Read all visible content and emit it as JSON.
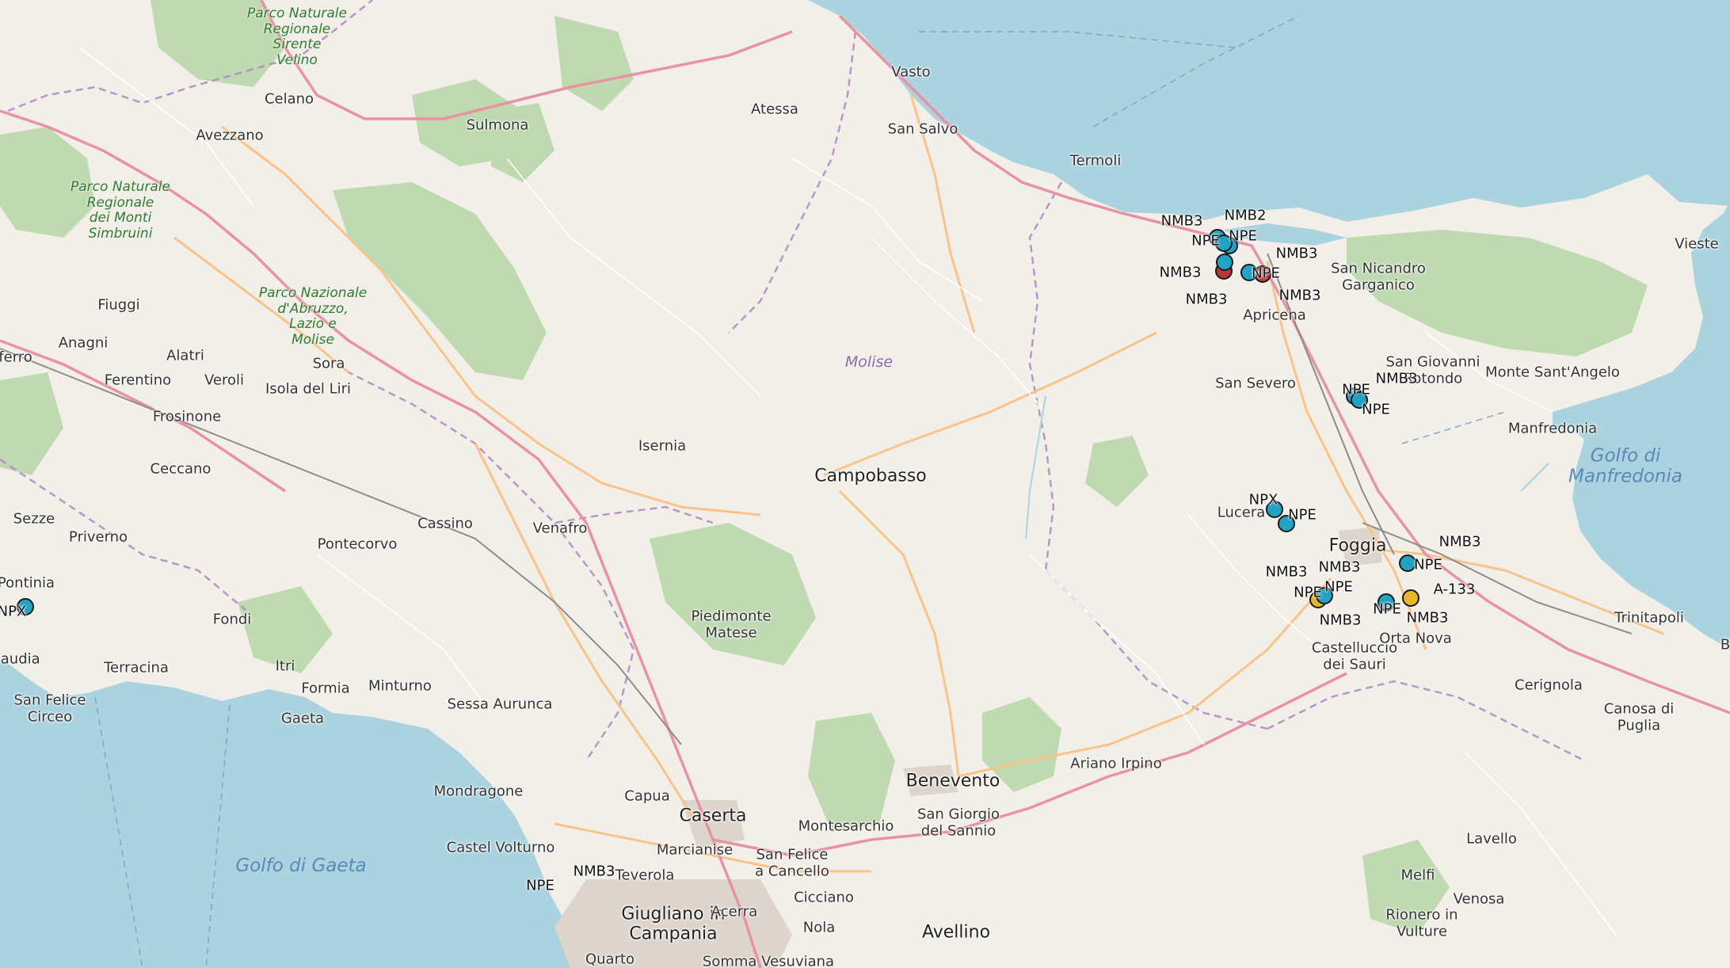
{
  "map": {
    "colors": {
      "land": "#f2efe9",
      "sea": "#aad3df",
      "forest": "#add19e",
      "motorway": "#e892a2",
      "primary": "#fcd6a4",
      "border": "#b08cc4",
      "marker_blue": "#22a3c6",
      "marker_red": "#b8373a",
      "marker_yellow": "#e8b62b"
    },
    "places": [
      {
        "text": "Vasto",
        "kind": "place"
      },
      {
        "text": "Atessa",
        "kind": "place"
      },
      {
        "text": "San Salvo",
        "kind": "place"
      },
      {
        "text": "Termoli",
        "kind": "place"
      },
      {
        "text": "Celano",
        "kind": "place"
      },
      {
        "text": "Sulmona",
        "kind": "place"
      },
      {
        "text": "Avezzano",
        "kind": "place"
      },
      {
        "text": "Fiuggi",
        "kind": "place"
      },
      {
        "text": "Anagni",
        "kind": "place"
      },
      {
        "text": "Alatri",
        "kind": "place"
      },
      {
        "text": "Ferentino",
        "kind": "place"
      },
      {
        "text": "Veroli",
        "kind": "place"
      },
      {
        "text": "Sora",
        "kind": "place"
      },
      {
        "text": "Isola del Liri",
        "kind": "place"
      },
      {
        "text": "Frosinone",
        "kind": "place"
      },
      {
        "text": "Ceccano",
        "kind": "place"
      },
      {
        "text": "Isernia",
        "kind": "place"
      },
      {
        "text": "Campobasso",
        "kind": "city"
      },
      {
        "text": "Cassino",
        "kind": "place"
      },
      {
        "text": "Venafro",
        "kind": "place"
      },
      {
        "text": "Pontecorvo",
        "kind": "place"
      },
      {
        "text": "Sezze",
        "kind": "place"
      },
      {
        "text": "Priverno",
        "kind": "place"
      },
      {
        "text": "Pontinia",
        "kind": "place"
      },
      {
        "text": "baudia",
        "kind": "place"
      },
      {
        "text": "Fondi",
        "kind": "place"
      },
      {
        "text": "Terracina",
        "kind": "place"
      },
      {
        "text": "Itri",
        "kind": "place"
      },
      {
        "text": "Formia",
        "kind": "place"
      },
      {
        "text": "Minturno",
        "kind": "place"
      },
      {
        "text": "Gaeta",
        "kind": "place"
      },
      {
        "text": "San Felice\nCirceo",
        "kind": "place"
      },
      {
        "text": "Sessa Aurunca",
        "kind": "place"
      },
      {
        "text": "Piedimonte\nMatese",
        "kind": "place"
      },
      {
        "text": "Mondragone",
        "kind": "place"
      },
      {
        "text": "Capua",
        "kind": "place"
      },
      {
        "text": "Caserta",
        "kind": "city"
      },
      {
        "text": "Marcianise",
        "kind": "place"
      },
      {
        "text": "Castel Volturno",
        "kind": "place"
      },
      {
        "text": "Teverola",
        "kind": "place"
      },
      {
        "text": "Giugliano in\nCampania",
        "kind": "city"
      },
      {
        "text": "Acerra",
        "kind": "place"
      },
      {
        "text": "Montesarchio",
        "kind": "place"
      },
      {
        "text": "San Felice\na Cancello",
        "kind": "place"
      },
      {
        "text": "Cicciano",
        "kind": "place"
      },
      {
        "text": "Nola",
        "kind": "place"
      },
      {
        "text": "Quarto",
        "kind": "place"
      },
      {
        "text": "Somma Vesuviana",
        "kind": "place"
      },
      {
        "text": "Benevento",
        "kind": "city"
      },
      {
        "text": "San Giorgio\ndel Sannio",
        "kind": "place"
      },
      {
        "text": "Avellino",
        "kind": "city"
      },
      {
        "text": "Ariano Irpino",
        "kind": "place"
      },
      {
        "text": "Lucera",
        "kind": "place"
      },
      {
        "text": "Foggia",
        "kind": "city"
      },
      {
        "text": "San Severo",
        "kind": "place"
      },
      {
        "text": "Apricena",
        "kind": "place"
      },
      {
        "text": "San Nicandro\nGarganico",
        "kind": "place"
      },
      {
        "text": "San Giovanni\nRotondo",
        "kind": "place"
      },
      {
        "text": "Monte Sant'Angelo",
        "kind": "place"
      },
      {
        "text": "Vieste",
        "kind": "place"
      },
      {
        "text": "Manfredonia",
        "kind": "place"
      },
      {
        "text": "Castelluccio\ndei Sauri",
        "kind": "place"
      },
      {
        "text": "Orta Nova",
        "kind": "place"
      },
      {
        "text": "Trinitapoli",
        "kind": "place"
      },
      {
        "text": "Cerignola",
        "kind": "place"
      },
      {
        "text": "Canosa di\nPuglia",
        "kind": "place"
      },
      {
        "text": "Lavello",
        "kind": "place"
      },
      {
        "text": "Melfi",
        "kind": "place"
      },
      {
        "text": "Venosa",
        "kind": "place"
      },
      {
        "text": "Rionero in\nVulture",
        "kind": "place"
      },
      {
        "text": "Parco Naturale\nRegionale\nSirente\nVelino",
        "kind": "park"
      },
      {
        "text": "Parco Naturale\nRegionale\ndei Monti\nSimbruini",
        "kind": "park"
      },
      {
        "text": "Parco Nazionale\nd'Abruzzo,\nLazio e\nMolise",
        "kind": "park"
      },
      {
        "text": "Molise",
        "kind": "region"
      },
      {
        "text": "Golfo di Gaeta",
        "kind": "sea"
      },
      {
        "text": "Golfo di\nManfredonia",
        "kind": "sea"
      },
      {
        "text": "eferro",
        "kind": "place"
      },
      {
        "text": "B",
        "kind": "place"
      }
    ],
    "markers": [
      {
        "color": "blue"
      },
      {
        "color": "blue"
      },
      {
        "color": "blue"
      },
      {
        "color": "red"
      },
      {
        "color": "blue"
      },
      {
        "color": "red"
      },
      {
        "color": "blue"
      },
      {
        "color": "blue"
      },
      {
        "color": "blue"
      },
      {
        "color": "blue"
      },
      {
        "color": "blue"
      },
      {
        "color": "blue"
      },
      {
        "color": "yellow"
      },
      {
        "color": "yellow"
      },
      {
        "color": "blue"
      },
      {
        "color": "yellow"
      },
      {
        "color": "blue"
      },
      {
        "color": "blue"
      }
    ],
    "codes": [
      "NMB3",
      "NMB2",
      "NPE",
      "NPE",
      "NMB3",
      "NMB3",
      "NPE",
      "NMB3",
      "NMB3",
      "NPE",
      "NMB3",
      "NPE",
      "NPX",
      "NPE",
      "NMB3",
      "NPE",
      "NMB3",
      "NMB3",
      "NPE",
      "NPE",
      "NMB3",
      "NPE",
      "A-133",
      "NMB3",
      "NPX",
      "NMB3",
      "NPE"
    ]
  }
}
